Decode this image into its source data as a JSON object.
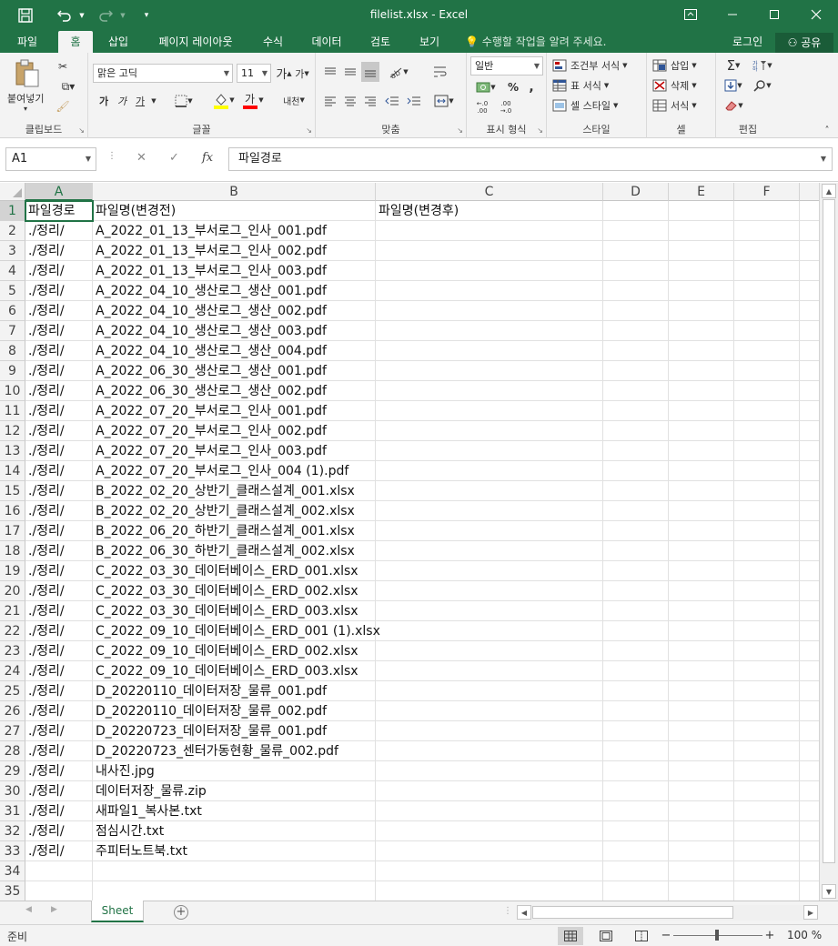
{
  "app": {
    "title": "filelist.xlsx - Excel"
  },
  "quick_access": {
    "save_icon": "save-icon",
    "undo_icon": "undo-icon",
    "redo_icon": "redo-icon",
    "customize_icon": "customize-qat-icon"
  },
  "window_controls": {
    "ribbon_display_icon": "ribbon-display-options-icon",
    "minimize_icon": "minimize-icon",
    "maximize_icon": "maximize-icon",
    "close_icon": "close-icon"
  },
  "tabs": [
    {
      "label": "파일",
      "active": false
    },
    {
      "label": "홈",
      "active": true
    },
    {
      "label": "삽입",
      "active": false
    },
    {
      "label": "페이지 레이아웃",
      "active": false
    },
    {
      "label": "수식",
      "active": false
    },
    {
      "label": "데이터",
      "active": false
    },
    {
      "label": "검토",
      "active": false
    },
    {
      "label": "보기",
      "active": false
    }
  ],
  "tell_me": "수행할 작업을 알려 주세요.",
  "sign_in": "로그인",
  "share": "공유",
  "ribbon": {
    "clipboard": {
      "label": "클립보드",
      "paste": "붙여넣기"
    },
    "font": {
      "label": "글꼴",
      "font_name": "맑은 고딕",
      "font_size": "11",
      "bold": "가",
      "italic": "가",
      "underline": "가",
      "strike": "내천"
    },
    "alignment": {
      "label": "맞춤"
    },
    "number": {
      "label": "표시 형식",
      "format": "일반"
    },
    "styles": {
      "label": "스타일",
      "conditional": "조건부 서식",
      "table": "표 서식",
      "cell_styles": "셀 스타일"
    },
    "cells": {
      "label": "셀",
      "insert": "삽입",
      "delete": "삭제",
      "format": "서식"
    },
    "editing": {
      "label": "편집"
    }
  },
  "formula_bar": {
    "name_box": "A1",
    "formula": "파일경로"
  },
  "columns": [
    "A",
    "B",
    "C",
    "D",
    "E",
    "F"
  ],
  "rows": [
    {
      "num": "1",
      "a": "파일경로",
      "b": "파일명(변경전)",
      "c": "파일명(변경후)"
    },
    {
      "num": "2",
      "a": "./정리/",
      "b": "A_2022_01_13_부서로그_인사_001.pdf",
      "c": ""
    },
    {
      "num": "3",
      "a": "./정리/",
      "b": "A_2022_01_13_부서로그_인사_002.pdf",
      "c": ""
    },
    {
      "num": "4",
      "a": "./정리/",
      "b": "A_2022_01_13_부서로그_인사_003.pdf",
      "c": ""
    },
    {
      "num": "5",
      "a": "./정리/",
      "b": "A_2022_04_10_생산로그_생산_001.pdf",
      "c": ""
    },
    {
      "num": "6",
      "a": "./정리/",
      "b": "A_2022_04_10_생산로그_생산_002.pdf",
      "c": ""
    },
    {
      "num": "7",
      "a": "./정리/",
      "b": "A_2022_04_10_생산로그_생산_003.pdf",
      "c": ""
    },
    {
      "num": "8",
      "a": "./정리/",
      "b": "A_2022_04_10_생산로그_생산_004.pdf",
      "c": ""
    },
    {
      "num": "9",
      "a": "./정리/",
      "b": "A_2022_06_30_생산로그_생산_001.pdf",
      "c": ""
    },
    {
      "num": "10",
      "a": "./정리/",
      "b": "A_2022_06_30_생산로그_생산_002.pdf",
      "c": ""
    },
    {
      "num": "11",
      "a": "./정리/",
      "b": "A_2022_07_20_부서로그_인사_001.pdf",
      "c": ""
    },
    {
      "num": "12",
      "a": "./정리/",
      "b": "A_2022_07_20_부서로그_인사_002.pdf",
      "c": ""
    },
    {
      "num": "13",
      "a": "./정리/",
      "b": "A_2022_07_20_부서로그_인사_003.pdf",
      "c": ""
    },
    {
      "num": "14",
      "a": "./정리/",
      "b": "A_2022_07_20_부서로그_인사_004 (1).pdf",
      "c": ""
    },
    {
      "num": "15",
      "a": "./정리/",
      "b": "B_2022_02_20_상반기_클래스설계_001.xlsx",
      "c": ""
    },
    {
      "num": "16",
      "a": "./정리/",
      "b": "B_2022_02_20_상반기_클래스설계_002.xlsx",
      "c": ""
    },
    {
      "num": "17",
      "a": "./정리/",
      "b": "B_2022_06_20_하반기_클래스설계_001.xlsx",
      "c": ""
    },
    {
      "num": "18",
      "a": "./정리/",
      "b": "B_2022_06_30_하반기_클래스설계_002.xlsx",
      "c": ""
    },
    {
      "num": "19",
      "a": "./정리/",
      "b": "C_2022_03_30_데이터베이스_ERD_001.xlsx",
      "c": ""
    },
    {
      "num": "20",
      "a": "./정리/",
      "b": "C_2022_03_30_데이터베이스_ERD_002.xlsx",
      "c": ""
    },
    {
      "num": "21",
      "a": "./정리/",
      "b": "C_2022_03_30_데이터베이스_ERD_003.xlsx",
      "c": ""
    },
    {
      "num": "22",
      "a": "./정리/",
      "b": "C_2022_09_10_데이터베이스_ERD_001 (1).xlsx",
      "c": ""
    },
    {
      "num": "23",
      "a": "./정리/",
      "b": "C_2022_09_10_데이터베이스_ERD_002.xlsx",
      "c": ""
    },
    {
      "num": "24",
      "a": "./정리/",
      "b": "C_2022_09_10_데이터베이스_ERD_003.xlsx",
      "c": ""
    },
    {
      "num": "25",
      "a": "./정리/",
      "b": "D_20220110_데이터저장_물류_001.pdf",
      "c": ""
    },
    {
      "num": "26",
      "a": "./정리/",
      "b": "D_20220110_데이터저장_물류_002.pdf",
      "c": ""
    },
    {
      "num": "27",
      "a": "./정리/",
      "b": "D_20220723_데이터저장_물류_001.pdf",
      "c": ""
    },
    {
      "num": "28",
      "a": "./정리/",
      "b": "D_20220723_센터가동현황_물류_002.pdf",
      "c": ""
    },
    {
      "num": "29",
      "a": "./정리/",
      "b": "내사진.jpg",
      "c": ""
    },
    {
      "num": "30",
      "a": "./정리/",
      "b": "데이터저장_물류.zip",
      "c": ""
    },
    {
      "num": "31",
      "a": "./정리/",
      "b": "새파일1_복사본.txt",
      "c": ""
    },
    {
      "num": "32",
      "a": "./정리/",
      "b": "점심시간.txt",
      "c": ""
    },
    {
      "num": "33",
      "a": "./정리/",
      "b": "주피터노트북.txt",
      "c": ""
    },
    {
      "num": "34",
      "a": "",
      "b": "",
      "c": ""
    },
    {
      "num": "35",
      "a": "",
      "b": "",
      "c": ""
    }
  ],
  "sheets": [
    {
      "label": "Sheet",
      "active": true
    }
  ],
  "status": {
    "ready": "준비",
    "zoom": "100 %"
  },
  "colors": {
    "brand": "#217346",
    "ribbon_bg": "#f3f3f3"
  }
}
